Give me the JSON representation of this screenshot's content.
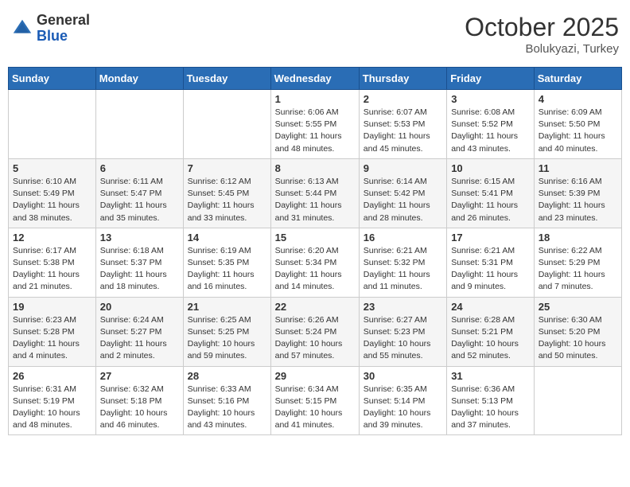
{
  "header": {
    "logo_general": "General",
    "logo_blue": "Blue",
    "month_year": "October 2025",
    "location": "Bolukyazi, Turkey"
  },
  "weekdays": [
    "Sunday",
    "Monday",
    "Tuesday",
    "Wednesday",
    "Thursday",
    "Friday",
    "Saturday"
  ],
  "weeks": [
    [
      {
        "day": "",
        "info": ""
      },
      {
        "day": "",
        "info": ""
      },
      {
        "day": "",
        "info": ""
      },
      {
        "day": "1",
        "info": "Sunrise: 6:06 AM\nSunset: 5:55 PM\nDaylight: 11 hours\nand 48 minutes."
      },
      {
        "day": "2",
        "info": "Sunrise: 6:07 AM\nSunset: 5:53 PM\nDaylight: 11 hours\nand 45 minutes."
      },
      {
        "day": "3",
        "info": "Sunrise: 6:08 AM\nSunset: 5:52 PM\nDaylight: 11 hours\nand 43 minutes."
      },
      {
        "day": "4",
        "info": "Sunrise: 6:09 AM\nSunset: 5:50 PM\nDaylight: 11 hours\nand 40 minutes."
      }
    ],
    [
      {
        "day": "5",
        "info": "Sunrise: 6:10 AM\nSunset: 5:49 PM\nDaylight: 11 hours\nand 38 minutes."
      },
      {
        "day": "6",
        "info": "Sunrise: 6:11 AM\nSunset: 5:47 PM\nDaylight: 11 hours\nand 35 minutes."
      },
      {
        "day": "7",
        "info": "Sunrise: 6:12 AM\nSunset: 5:45 PM\nDaylight: 11 hours\nand 33 minutes."
      },
      {
        "day": "8",
        "info": "Sunrise: 6:13 AM\nSunset: 5:44 PM\nDaylight: 11 hours\nand 31 minutes."
      },
      {
        "day": "9",
        "info": "Sunrise: 6:14 AM\nSunset: 5:42 PM\nDaylight: 11 hours\nand 28 minutes."
      },
      {
        "day": "10",
        "info": "Sunrise: 6:15 AM\nSunset: 5:41 PM\nDaylight: 11 hours\nand 26 minutes."
      },
      {
        "day": "11",
        "info": "Sunrise: 6:16 AM\nSunset: 5:39 PM\nDaylight: 11 hours\nand 23 minutes."
      }
    ],
    [
      {
        "day": "12",
        "info": "Sunrise: 6:17 AM\nSunset: 5:38 PM\nDaylight: 11 hours\nand 21 minutes."
      },
      {
        "day": "13",
        "info": "Sunrise: 6:18 AM\nSunset: 5:37 PM\nDaylight: 11 hours\nand 18 minutes."
      },
      {
        "day": "14",
        "info": "Sunrise: 6:19 AM\nSunset: 5:35 PM\nDaylight: 11 hours\nand 16 minutes."
      },
      {
        "day": "15",
        "info": "Sunrise: 6:20 AM\nSunset: 5:34 PM\nDaylight: 11 hours\nand 14 minutes."
      },
      {
        "day": "16",
        "info": "Sunrise: 6:21 AM\nSunset: 5:32 PM\nDaylight: 11 hours\nand 11 minutes."
      },
      {
        "day": "17",
        "info": "Sunrise: 6:21 AM\nSunset: 5:31 PM\nDaylight: 11 hours\nand 9 minutes."
      },
      {
        "day": "18",
        "info": "Sunrise: 6:22 AM\nSunset: 5:29 PM\nDaylight: 11 hours\nand 7 minutes."
      }
    ],
    [
      {
        "day": "19",
        "info": "Sunrise: 6:23 AM\nSunset: 5:28 PM\nDaylight: 11 hours\nand 4 minutes."
      },
      {
        "day": "20",
        "info": "Sunrise: 6:24 AM\nSunset: 5:27 PM\nDaylight: 11 hours\nand 2 minutes."
      },
      {
        "day": "21",
        "info": "Sunrise: 6:25 AM\nSunset: 5:25 PM\nDaylight: 10 hours\nand 59 minutes."
      },
      {
        "day": "22",
        "info": "Sunrise: 6:26 AM\nSunset: 5:24 PM\nDaylight: 10 hours\nand 57 minutes."
      },
      {
        "day": "23",
        "info": "Sunrise: 6:27 AM\nSunset: 5:23 PM\nDaylight: 10 hours\nand 55 minutes."
      },
      {
        "day": "24",
        "info": "Sunrise: 6:28 AM\nSunset: 5:21 PM\nDaylight: 10 hours\nand 52 minutes."
      },
      {
        "day": "25",
        "info": "Sunrise: 6:30 AM\nSunset: 5:20 PM\nDaylight: 10 hours\nand 50 minutes."
      }
    ],
    [
      {
        "day": "26",
        "info": "Sunrise: 6:31 AM\nSunset: 5:19 PM\nDaylight: 10 hours\nand 48 minutes."
      },
      {
        "day": "27",
        "info": "Sunrise: 6:32 AM\nSunset: 5:18 PM\nDaylight: 10 hours\nand 46 minutes."
      },
      {
        "day": "28",
        "info": "Sunrise: 6:33 AM\nSunset: 5:16 PM\nDaylight: 10 hours\nand 43 minutes."
      },
      {
        "day": "29",
        "info": "Sunrise: 6:34 AM\nSunset: 5:15 PM\nDaylight: 10 hours\nand 41 minutes."
      },
      {
        "day": "30",
        "info": "Sunrise: 6:35 AM\nSunset: 5:14 PM\nDaylight: 10 hours\nand 39 minutes."
      },
      {
        "day": "31",
        "info": "Sunrise: 6:36 AM\nSunset: 5:13 PM\nDaylight: 10 hours\nand 37 minutes."
      },
      {
        "day": "",
        "info": ""
      }
    ]
  ]
}
